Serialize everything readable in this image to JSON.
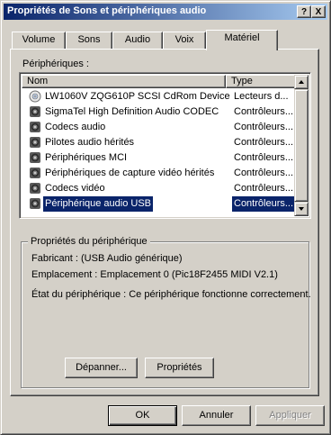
{
  "window": {
    "title": "Propriétés de Sons et périphériques audio",
    "help_button": "?",
    "close_button": "X"
  },
  "tabs": [
    {
      "label": "Volume"
    },
    {
      "label": "Sons"
    },
    {
      "label": "Audio"
    },
    {
      "label": "Voix"
    },
    {
      "label": "Matériel",
      "active": true
    }
  ],
  "devices": {
    "label": "Périphériques :",
    "columns": {
      "name": "Nom",
      "type": "Type"
    },
    "rows": [
      {
        "name": "LW1060V ZQG610P SCSI CdRom Device",
        "type": "Lecteurs d...",
        "icon": "cdrom-icon"
      },
      {
        "name": "SigmaTel High Definition Audio CODEC",
        "type": "Contrôleurs...",
        "icon": "speaker-icon"
      },
      {
        "name": "Codecs audio",
        "type": "Contrôleurs...",
        "icon": "speaker-icon"
      },
      {
        "name": "Pilotes audio hérités",
        "type": "Contrôleurs...",
        "icon": "speaker-icon"
      },
      {
        "name": "Périphériques MCI",
        "type": "Contrôleurs...",
        "icon": "speaker-icon"
      },
      {
        "name": "Périphériques de capture vidéo hérités",
        "type": "Contrôleurs...",
        "icon": "speaker-icon"
      },
      {
        "name": "Codecs vidéo",
        "type": "Contrôleurs...",
        "icon": "speaker-icon"
      },
      {
        "name": "Périphérique audio USB",
        "type": "Contrôleurs...",
        "icon": "speaker-icon",
        "selected": true
      }
    ]
  },
  "properties": {
    "title": "Propriétés du périphérique",
    "manufacturer": "Fabricant : (USB Audio générique)",
    "location": "Emplacement : Emplacement 0 (Pic18F2455 MIDI V2.1)",
    "status": "État du périphérique : Ce périphérique fonctionne correctement.",
    "troubleshoot_button": "Dépanner...",
    "properties_button": "Propriétés"
  },
  "footer": {
    "ok": "OK",
    "cancel": "Annuler",
    "apply": "Appliquer"
  },
  "colors": {
    "title_start": "#0a246a",
    "title_end": "#a6caf0",
    "selection": "#0a246a",
    "face": "#d4d0c8"
  }
}
